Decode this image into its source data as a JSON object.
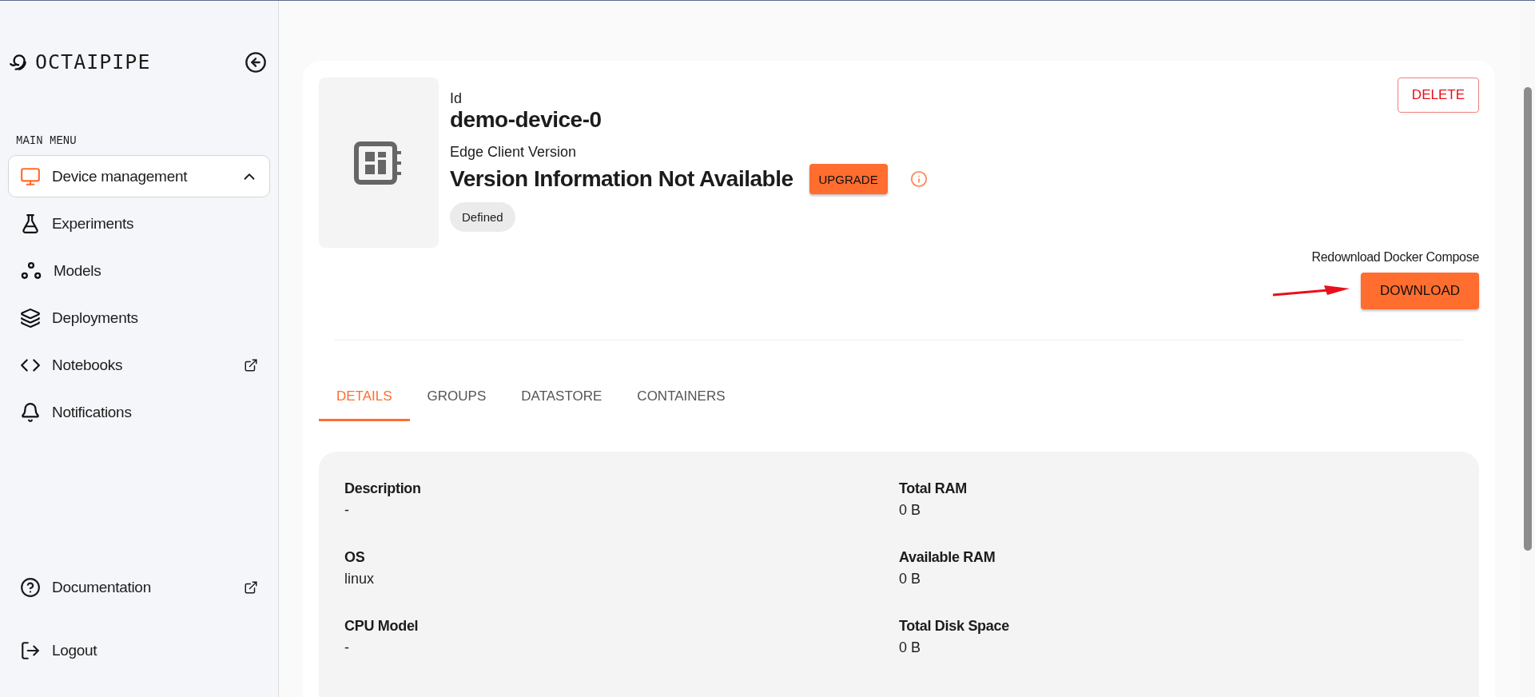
{
  "sidebar": {
    "logo": "OCTAIPIPE",
    "section_label": "MAIN MENU",
    "items": [
      {
        "label": "Device management",
        "selected": true,
        "expanded": true,
        "external": false
      },
      {
        "label": "Experiments",
        "selected": false,
        "external": false
      },
      {
        "label": "Models",
        "selected": false,
        "external": false
      },
      {
        "label": "Deployments",
        "selected": false,
        "external": false
      },
      {
        "label": "Notebooks",
        "selected": false,
        "external": true
      },
      {
        "label": "Notifications",
        "selected": false,
        "external": false
      }
    ],
    "footer_items": [
      {
        "label": "Documentation",
        "external": true
      },
      {
        "label": "Logout",
        "external": false
      }
    ]
  },
  "device": {
    "id_label": "Id",
    "id": "demo-device-0",
    "version_label": "Edge Client Version",
    "version": "Version Information Not Available",
    "upgrade_button": "UPGRADE",
    "status": "Defined",
    "delete_button": "DELETE",
    "redownload_label": "Redownload Docker Compose",
    "download_button": "DOWNLOAD"
  },
  "tabs": [
    {
      "label": "DETAILS",
      "selected": true
    },
    {
      "label": "GROUPS",
      "selected": false
    },
    {
      "label": "DATASTORE",
      "selected": false
    },
    {
      "label": "CONTAINERS",
      "selected": false
    }
  ],
  "details": {
    "left": [
      {
        "label": "Description",
        "value": "-"
      },
      {
        "label": "OS",
        "value": "linux"
      },
      {
        "label": "CPU Model",
        "value": "-"
      }
    ],
    "right": [
      {
        "label": "Total RAM",
        "value": "0 B"
      },
      {
        "label": "Available RAM",
        "value": "0 B"
      },
      {
        "label": "Total Disk Space",
        "value": "0 B"
      }
    ]
  }
}
